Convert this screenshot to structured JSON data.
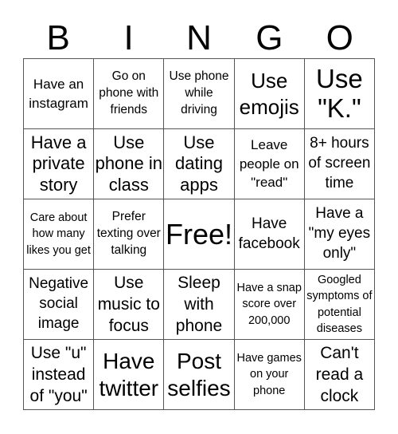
{
  "header": {
    "letters": [
      "B",
      "I",
      "N",
      "G",
      "O"
    ]
  },
  "board": {
    "rows": [
      [
        "Have an instagram",
        "Go on phone with friends",
        "Use phone while driving",
        "Use emojis",
        "Use \"K.\""
      ],
      [
        "Have a private story",
        "Use phone in class",
        "Use dating apps",
        "Leave people on \"read\"",
        "8+ hours of screen time"
      ],
      [
        "Care about how many likes you get",
        "Prefer texting over talking",
        "Free!",
        "Have facebook",
        "Have a \"my eyes only\""
      ],
      [
        "Negative social image",
        "Use music to focus",
        "Sleep with phone",
        "Have a snap score over 200,000",
        "Googled symptoms of potential diseases"
      ],
      [
        "Use \"u\" instead of \"you\"",
        "Have twitter",
        "Post selfies",
        "Have games on your phone",
        "Can't read a clock"
      ]
    ],
    "free_cell": "Free!"
  }
}
